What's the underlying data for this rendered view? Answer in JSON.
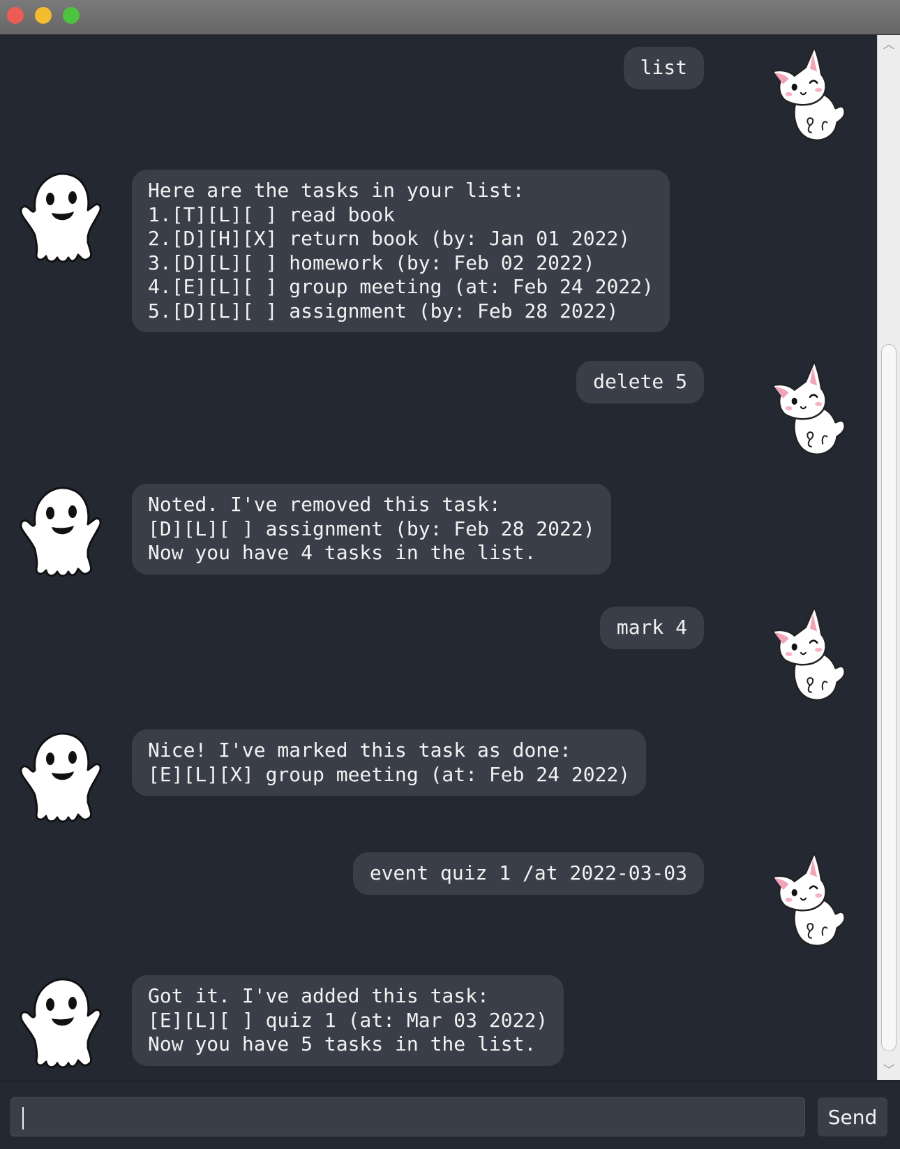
{
  "window": {
    "controls": [
      "close",
      "minimize",
      "maximize"
    ]
  },
  "messages": [
    {
      "sender": "user",
      "avatar": "cat-icon",
      "text": "list"
    },
    {
      "sender": "bot",
      "avatar": "ghost-icon",
      "text": "Here are the tasks in your list:\n1.[T][L][ ] read book\n2.[D][H][X] return book (by: Jan 01 2022)\n3.[D][L][ ] homework (by: Feb 02 2022)\n4.[E][L][ ] group meeting (at: Feb 24 2022)\n5.[D][L][ ] assignment (by: Feb 28 2022)"
    },
    {
      "sender": "user",
      "avatar": "cat-icon",
      "text": "delete 5"
    },
    {
      "sender": "bot",
      "avatar": "ghost-icon",
      "text": "Noted. I've removed this task:\n[D][L][ ] assignment (by: Feb 28 2022)\nNow you have 4 tasks in the list."
    },
    {
      "sender": "user",
      "avatar": "cat-icon",
      "text": "mark 4"
    },
    {
      "sender": "bot",
      "avatar": "ghost-icon",
      "text": "Nice! I've marked this task as done:\n[E][L][X] group meeting (at: Feb 24 2022)"
    },
    {
      "sender": "user",
      "avatar": "cat-icon",
      "text": "event quiz 1 /at 2022-03-03"
    },
    {
      "sender": "bot",
      "avatar": "ghost-icon",
      "text": "Got it. I've added this task:\n[E][L][ ] quiz 1 (at: Mar 03 2022)\nNow you have 5 tasks in the list."
    }
  ],
  "input": {
    "value": "",
    "placeholder": ""
  },
  "send_button": {
    "label": "Send"
  },
  "colors": {
    "background": "#232833",
    "bubble": "#3a3e48",
    "text": "#f2f2f2",
    "close": "#ee5d55",
    "minimize": "#f4bd2f",
    "maximize": "#4dc43f"
  }
}
